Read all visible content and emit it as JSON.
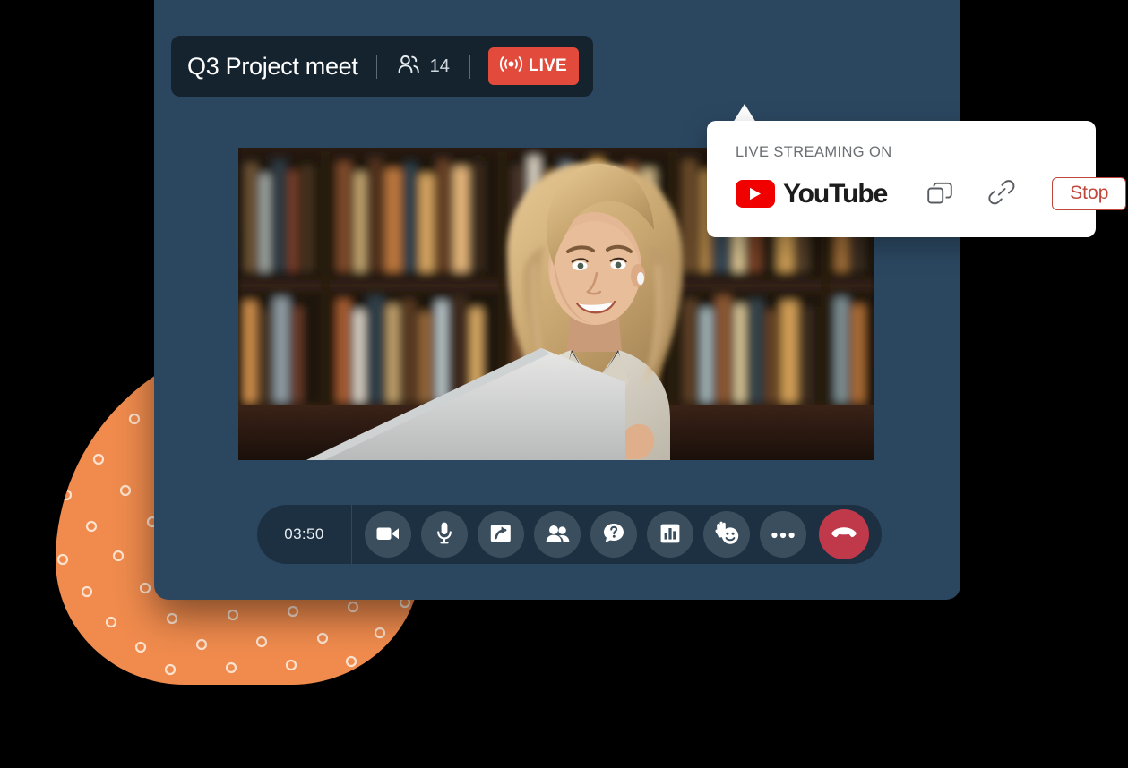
{
  "window": {
    "background_color": "#2b4760",
    "page_background": "#000000"
  },
  "decoration": {
    "shape_name": "orange-dotted-teardrop",
    "color": "#f08b4d",
    "dot_color": "#ffffff"
  },
  "header": {
    "title": "Q3 Project meet",
    "participants_icon": "people-icon",
    "participants_count": "14",
    "live_badge": {
      "label": "LIVE",
      "icon": "broadcast-icon",
      "background_color": "#e24b3c",
      "text_color": "#ffffff"
    },
    "background_color": "#15232e"
  },
  "video": {
    "alt": "Woman with blonde hair in cream blazer smiling at a laptop in front of a blurred bookshelf"
  },
  "popover": {
    "label": "LIVE STREAMING ON",
    "platform": "YouTube",
    "platform_icon": "youtube-play-icon",
    "platform_color": "#f10000",
    "copy_icon": "copy-icon",
    "link_icon": "link-icon",
    "stop_label": "Stop",
    "stop_color": "#c0483b",
    "background_color": "#ffffff"
  },
  "toolbar": {
    "timer": "03:50",
    "background_color": "#1c3041",
    "buttons": [
      {
        "name": "camera-button",
        "icon": "video-camera-icon",
        "label": "Camera"
      },
      {
        "name": "microphone-button",
        "icon": "microphone-icon",
        "label": "Microphone"
      },
      {
        "name": "share-screen-button",
        "icon": "share-screen-icon",
        "label": "Share screen"
      },
      {
        "name": "participants-button",
        "icon": "people-icon",
        "label": "Participants"
      },
      {
        "name": "qa-button",
        "icon": "question-bubble-icon",
        "label": "Q and A"
      },
      {
        "name": "polls-button",
        "icon": "bar-chart-icon",
        "label": "Polls"
      },
      {
        "name": "reactions-button",
        "icon": "raise-hand-smiley-icon",
        "label": "Reactions"
      },
      {
        "name": "more-options-button",
        "icon": "ellipsis-icon",
        "label": "More options"
      },
      {
        "name": "end-call-button",
        "icon": "phone-hangup-icon",
        "label": "End call"
      }
    ],
    "end_call_color": "#c0394a"
  }
}
